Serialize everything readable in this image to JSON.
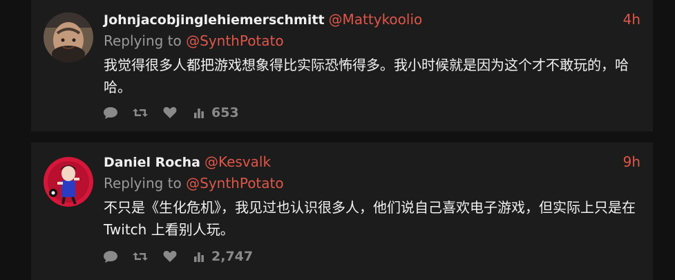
{
  "tweets": [
    {
      "display_name": "Johnjacobjinglehiemerschmitt",
      "handle": "@Mattykoolio",
      "timestamp": "4h",
      "replying_prefix": "Replying to",
      "replying_handle": "@SynthPotato",
      "text": "我觉得很多人都把游戏想象得比实际恐怖得多。我小时候就是因为这个才不敢玩的，哈哈。",
      "views": "653",
      "avatar_icon": "user-avatar-photo"
    },
    {
      "display_name": "Daniel Rocha",
      "handle": "@Kesvalk",
      "timestamp": "9h",
      "replying_prefix": "Replying to",
      "replying_handle": "@SynthPotato",
      "text": "不只是《生化危机》，我见过也认识很多人，他们说自己喜欢电子游戏，但实际上只是在 Twitch 上看别人玩。",
      "views": "2,747",
      "avatar_icon": "user-avatar-illustration"
    }
  ],
  "action_icons": [
    "reply-icon",
    "retweet-icon",
    "like-icon",
    "views-icon"
  ],
  "colors": {
    "background": "#111111",
    "card": "#1c1c1c",
    "accent": "#e0564a",
    "muted": "#8a8a8a",
    "text": "#f2f2f2"
  }
}
